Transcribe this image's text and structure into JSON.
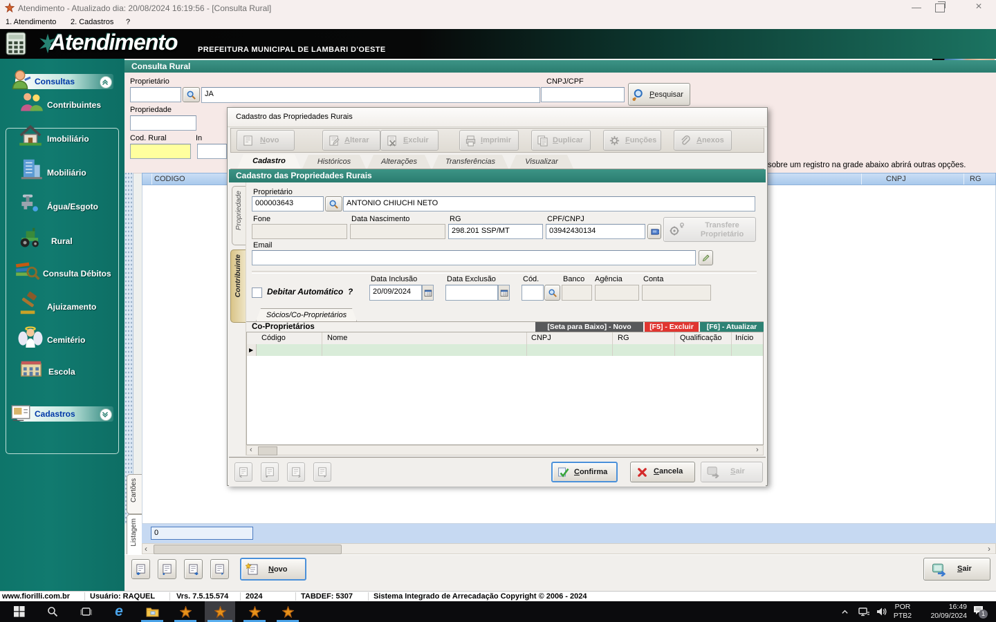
{
  "colors": {
    "teal_bar": "#2e8274",
    "sidebar_teal": "#0f7a6e",
    "badge_dark": "#58595b",
    "badge_red": "#e03530",
    "badge_teal": "#2e8274",
    "highlight_yellow": "#ffff9e",
    "grid_header_blue": "#b3d0ef",
    "row_green": "#d9ecd9"
  },
  "titlebar": {
    "title": "Atendimento - Atualizado dia: 20/08/2024 16:19:56 - [Consulta Rural]"
  },
  "menubar": {
    "items": [
      {
        "label": "1. Atendimento"
      },
      {
        "label": "2. Cadastros"
      },
      {
        "label": "?"
      }
    ]
  },
  "header": {
    "logo": "Atendimento",
    "subtitle": "PREFEITURA MUNICIPAL DE LAMBARI D'OESTE"
  },
  "sidebar": {
    "consultas": "Consultas",
    "cadastros": "Cadastros",
    "items": [
      {
        "label": "Contribuintes"
      },
      {
        "label": "Imobiliário"
      },
      {
        "label": "Mobiliário"
      },
      {
        "label": "Água/Esgoto"
      },
      {
        "label": "Rural"
      },
      {
        "label": "Consulta Débitos"
      },
      {
        "label": "Ajuizamento"
      },
      {
        "label": "Cemitério"
      },
      {
        "label": "Escola"
      }
    ]
  },
  "consulta_rural": {
    "title": "Consulta Rural",
    "proprietario_label": "Proprietário",
    "proprietario_code": "",
    "proprietario_name": "JA",
    "cnpj_label": "CNPJ/CPF",
    "cnpj_value": "",
    "pesquisar": "Pesquisar",
    "propriedade_label": "Propriedade",
    "propriedade_value": "",
    "cod_rural_label": "Cod. Rural",
    "truncated_label": "In",
    "hint": "sobre um registro na grade abaixo abrirá outras opções.",
    "columns": {
      "codigo": "CODIGO",
      "cnpj": "CNPJ",
      "rg": "RG"
    },
    "tabs": {
      "cartoes": "Cartões",
      "listagem": "Listagem"
    },
    "count": "0",
    "novo": "Novo",
    "sair": "Sair"
  },
  "dialog": {
    "title": "Cadastro das Propriedades Rurais",
    "toolbar": [
      {
        "label": "Novo"
      },
      {
        "label": "Alterar"
      },
      {
        "label": "Excluir"
      },
      {
        "label": "Imprimir"
      },
      {
        "label": "Duplicar"
      },
      {
        "label": "Funções"
      },
      {
        "label": "Anexos"
      }
    ],
    "tabs": [
      {
        "label": "Cadastro"
      },
      {
        "label": "Históricos"
      },
      {
        "label": "Alterações"
      },
      {
        "label": "Transferências"
      },
      {
        "label": "Visualizar"
      }
    ],
    "inner_title": "Cadastro das Propriedades Rurais",
    "side_tabs": [
      {
        "label": "Propriedade"
      },
      {
        "label": "Contribuinte"
      }
    ],
    "form": {
      "proprietario_label": "Proprietário",
      "proprietario_code": "000003643",
      "proprietario_name": "ANTONIO CHIUCHI NETO",
      "fone_label": "Fone",
      "fone_value": "",
      "data_nascimento_label": "Data Nascimento",
      "data_nascimento_value": "",
      "rg_label": "RG",
      "rg_value": "298.201 SSP/MT",
      "cpf_label": "CPF/CNPJ",
      "cpf_value": "03942430134",
      "transfere_label": "Transfere Proprietário",
      "email_label": "Email",
      "email_value": "",
      "debitar_label": "Debitar Automático",
      "debitar_suffix": "?",
      "data_inclusao_label": "Data Inclusão",
      "data_inclusao_value": "20/09/2024",
      "data_exclusao_label": "Data Exclusão",
      "data_exclusao_value": "",
      "cod_label": "Cód.",
      "banco_label": "Banco",
      "agencia_label": "Agência",
      "conta_label": "Conta"
    },
    "socios_tab": "Sócios/Co-Proprietários",
    "coproprietarios": {
      "header": "Co-Proprietários",
      "badge_novo": "[Seta para Baixo] - Novo",
      "badge_excluir": "[F5] - Excluir",
      "badge_atualizar": "[F6] - Atualizar",
      "columns": [
        {
          "label": "Código"
        },
        {
          "label": "Nome"
        },
        {
          "label": "CNPJ"
        },
        {
          "label": "RG"
        },
        {
          "label": "Qualificação"
        },
        {
          "label": "Início"
        }
      ]
    },
    "buttons": {
      "confirma": "Confirma",
      "cancela": "Cancela",
      "sair": "Sair"
    }
  },
  "statusbar": {
    "segments": [
      {
        "text": "www.fiorilli.com.br"
      },
      {
        "text": "Usuário: RAQUEL"
      },
      {
        "text": "Vrs. 7.5.15.574"
      },
      {
        "text": "2024"
      },
      {
        "text": "TABDEF: 5307"
      },
      {
        "text": "Sistema Integrado de Arrecadação Copyright © 2006 - 2024"
      }
    ]
  },
  "taskbar": {
    "lang_line1": "POR",
    "lang_line2": "PTB2",
    "time": "16:49",
    "date": "20/09/2024",
    "badge": "1"
  }
}
